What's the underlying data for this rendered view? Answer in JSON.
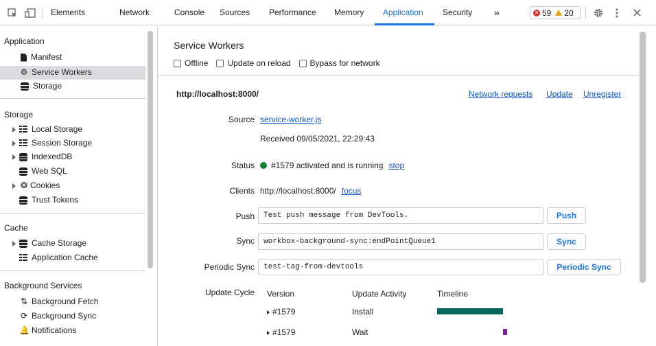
{
  "toolbar": {
    "tabs": [
      "Elements",
      "Network",
      "Console",
      "Sources",
      "Performance",
      "Memory",
      "Application",
      "Security"
    ],
    "more": "»",
    "errors": "59",
    "warnings": "20"
  },
  "sidebar": {
    "application_heading": "Application",
    "application_items": [
      "Manifest",
      "Service Workers",
      "Storage"
    ],
    "storage_heading": "Storage",
    "storage_items": [
      "Local Storage",
      "Session Storage",
      "IndexedDB",
      "Web SQL",
      "Cookies",
      "Trust Tokens"
    ],
    "cache_heading": "Cache",
    "cache_items": [
      "Cache Storage",
      "Application Cache"
    ],
    "bg_heading": "Background Services",
    "bg_items": [
      "Background Fetch",
      "Background Sync",
      "Notifications"
    ]
  },
  "main": {
    "title": "Service Workers",
    "options": [
      "Offline",
      "Update on reload",
      "Bypass for network"
    ],
    "origin": "http://localhost:8000/",
    "header_links": [
      "Network requests",
      "Update",
      "Unregister"
    ],
    "source_label": "Source",
    "source_link": "service-worker.js",
    "received": "Received 09/05/2021, 22:29:43",
    "status_label": "Status",
    "status_text": "#1579 activated and is running",
    "status_link": "stop",
    "clients_label": "Clients",
    "clients_text": "http://localhost:8000/",
    "clients_link": "focus",
    "push_label": "Push",
    "push_value": "Test push message from DevTools.",
    "push_button": "Push",
    "sync_label": "Sync",
    "sync_value": "workbox-background-sync:endPointQueue1",
    "sync_button": "Sync",
    "periodic_label": "Periodic Sync",
    "periodic_value": "test-tag-from-devtools",
    "periodic_button": "Periodic Sync",
    "update_cycle_label": "Update Cycle",
    "uc_headers": [
      "Version",
      "Update Activity",
      "Timeline"
    ],
    "uc_rows": [
      {
        "version": "#1579",
        "activity": "Install",
        "color": "#00695c"
      },
      {
        "version": "#1579",
        "activity": "Wait",
        "color": "#7b1fa2"
      }
    ]
  },
  "colors": {
    "accent": "#1a73e8",
    "error": "#d93025",
    "warning": "#f4a100",
    "running": "#188038"
  }
}
